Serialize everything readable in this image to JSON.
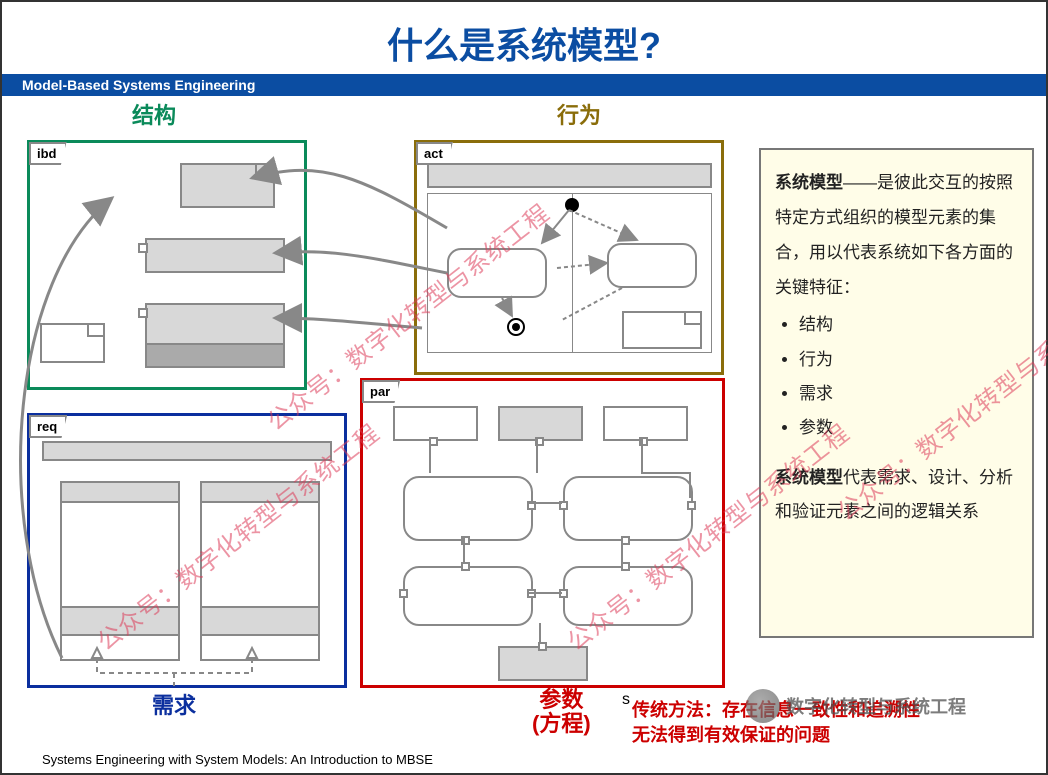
{
  "title": "什么是系统模型?",
  "banner": "Model-Based Systems Engineering",
  "labels": {
    "structure": "结构",
    "behavior": "行为",
    "requirement": "需求",
    "parameter_line1": "参数",
    "parameter_line2": "(方程)"
  },
  "panels": {
    "ibd": "ibd",
    "act": "act",
    "req": "req",
    "par": "par"
  },
  "info": {
    "heading_strong": "系统模型",
    "heading_rest": "——是彼此交互的按照特定方式组织的模型元素的集合，用以代表系统如下各方面的关键特征：",
    "bullets": [
      "结构",
      "行为",
      "需求",
      "参数"
    ],
    "para2_strong": "系统模型",
    "para2_rest": "代表需求、设计、分析和验证元素之间的逻辑关系"
  },
  "red_note": {
    "line1": "传统方法：存在信息一致性和追溯性",
    "line2": "无法得到有效保证的问题"
  },
  "stray_s": "s",
  "footer": "Systems Engineering with System Models: An Introduction to MBSE",
  "watermark": "公众号：数字化转型与系统工程",
  "logo_watermark": "数字化转型与系统工程"
}
